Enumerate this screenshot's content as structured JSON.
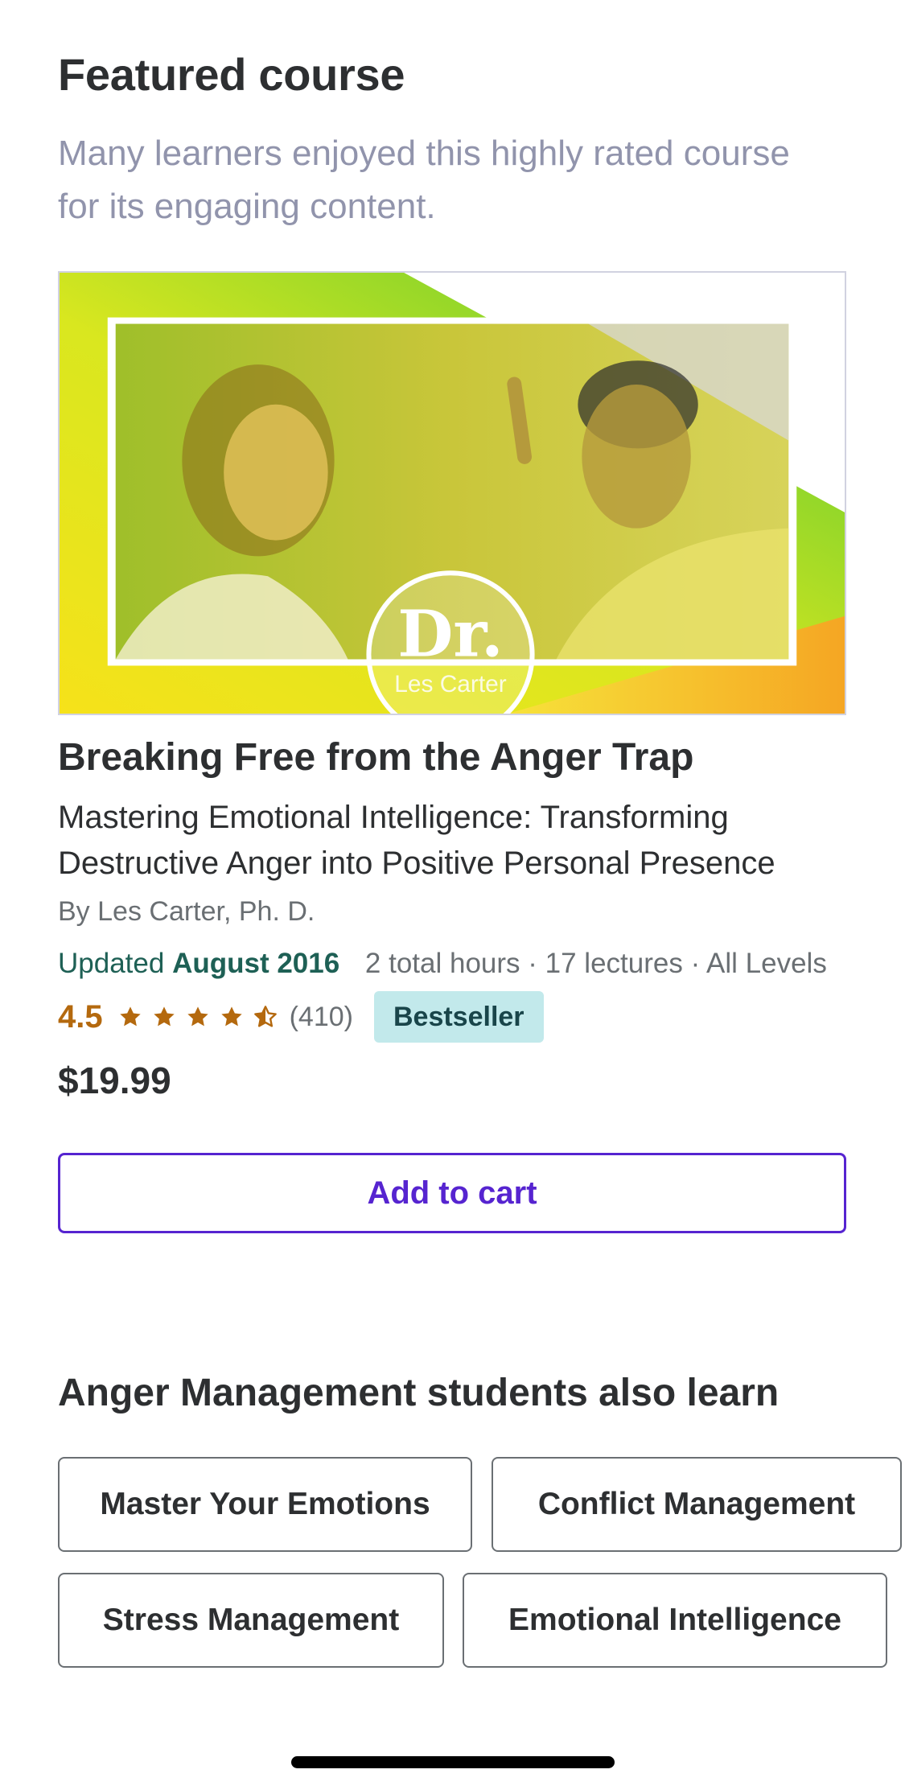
{
  "featured": {
    "title": "Featured course",
    "subtitle": "Many learners enjoyed this highly rated course for its engaging content."
  },
  "course": {
    "image_logo_text": "Dr.",
    "image_logo_subtext": "Les Carter",
    "title": "Breaking Free from the Anger Trap",
    "headline": "Mastering Emotional Intelligence: Transforming Destructive Anger into Positive Personal Presence",
    "author": "By Les Carter, Ph. D.",
    "updated_label": "Updated",
    "updated_date": "August 2016",
    "stats": "2 total hours · 17 lectures · All Levels",
    "rating": "4.5",
    "rating_count": "(410)",
    "stars_filled": 4.5,
    "stars_total": 5,
    "badge": "Bestseller",
    "price": "$19.99",
    "add_to_cart": "Add to cart"
  },
  "related": {
    "title": "Anger Management students also learn",
    "topics": [
      "Master Your Emotions",
      "Conflict Management",
      "Stress Management",
      "Emotional Intelligence"
    ]
  },
  "colors": {
    "primary": "#5624d0",
    "text": "#2d2f31",
    "muted": "#6a6f73",
    "subtitle": "#9194ac",
    "rating": "#b4690e",
    "updated": "#1e6055",
    "badge_bg": "#c2e9eb",
    "badge_text": "#19454a"
  },
  "icons": {
    "star": "star-icon",
    "half_star": "half-star-icon"
  }
}
